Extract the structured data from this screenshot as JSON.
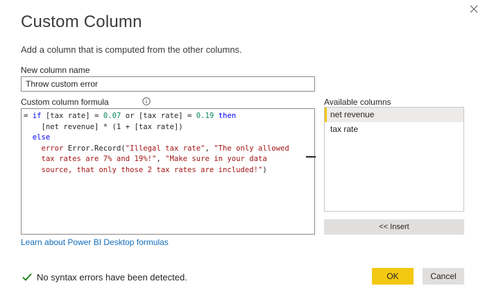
{
  "dialog": {
    "title": "Custom Column",
    "subtitle": "Add a column that is computed from the other columns."
  },
  "name_field": {
    "label": "New column name",
    "value": "Throw custom error"
  },
  "formula": {
    "label": "Custom column formula",
    "lines": [
      [
        {
          "t": "= "
        },
        {
          "t": "if",
          "c": "kw"
        },
        {
          "t": " [tax rate] = "
        },
        {
          "t": "0.07",
          "c": "num"
        },
        {
          "t": " or [tax rate] = "
        },
        {
          "t": "0.19",
          "c": "num"
        },
        {
          "t": " "
        },
        {
          "t": "then",
          "c": "kw"
        }
      ],
      [
        {
          "t": "    [net revenue] * (1 + [tax rate])"
        }
      ],
      [
        {
          "t": "  "
        },
        {
          "t": "else",
          "c": "kw"
        }
      ],
      [
        {
          "t": "    "
        },
        {
          "t": "error",
          "c": "str"
        },
        {
          "t": " Error.Record("
        },
        {
          "t": "\"Illegal tax rate\"",
          "c": "str"
        },
        {
          "t": ", "
        },
        {
          "t": "\"The only allowed",
          "c": "str"
        }
      ],
      [
        {
          "t": "    tax rates are 7% and 19%!\"",
          "c": "str"
        },
        {
          "t": ", "
        },
        {
          "t": "\"Make sure in your data",
          "c": "str"
        }
      ],
      [
        {
          "t": "    source, that only those 2 tax rates are included!\"",
          "c": "str"
        },
        {
          "t": ")"
        }
      ]
    ]
  },
  "available_columns": {
    "label": "Available columns",
    "items": [
      {
        "label": "net revenue",
        "selected": true
      },
      {
        "label": "tax rate",
        "selected": false
      }
    ],
    "insert_label": "<< Insert"
  },
  "learn_link": "Learn about Power BI Desktop formulas",
  "status": {
    "text": "No syntax errors have been detected.",
    "icon": "checkmark-icon",
    "color": "#107c10"
  },
  "buttons": {
    "ok": "OK",
    "cancel": "Cancel"
  },
  "colors": {
    "accent": "#f2c811",
    "link": "#0f6cbd"
  }
}
